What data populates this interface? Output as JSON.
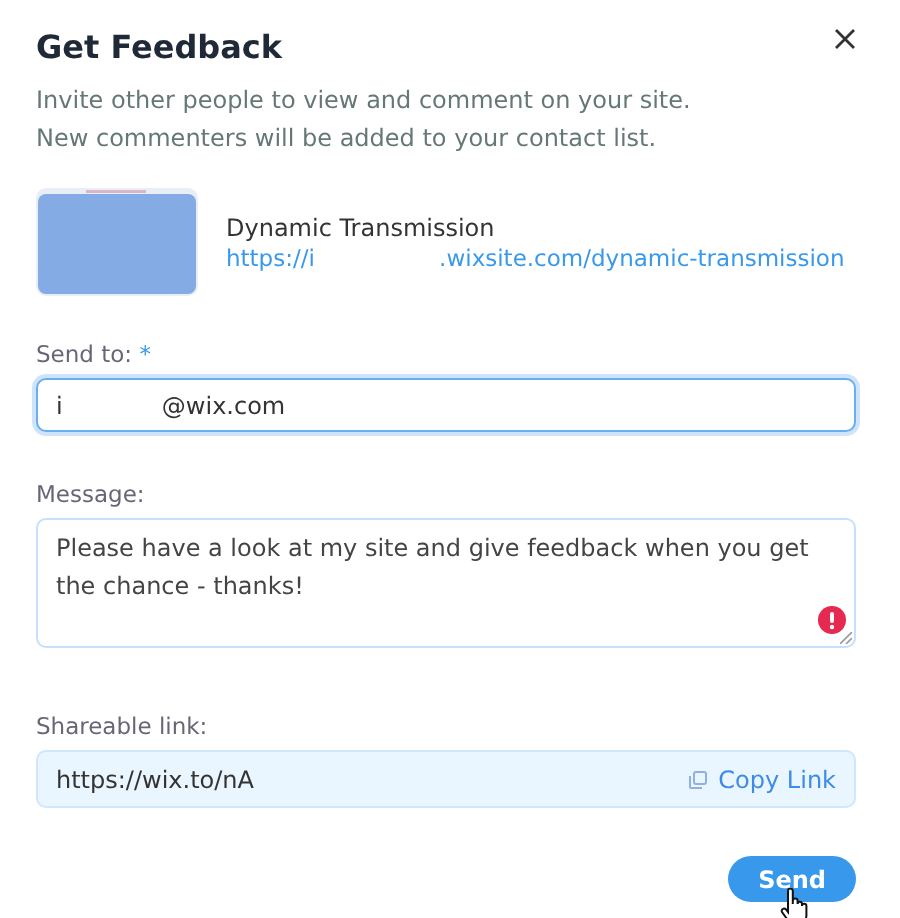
{
  "dialog": {
    "title": "Get Feedback",
    "description": [
      "Invite other people to view and comment on your site.",
      "New commenters will be added to your contact list."
    ]
  },
  "site": {
    "name": "Dynamic Transmission",
    "url": "https://i                 .wixsite.com/dynamic-transmission"
  },
  "send_to": {
    "label": "Send to:",
    "required_mark": "*",
    "value": "i             @wix.com",
    "focused": true
  },
  "message": {
    "label": "Message:",
    "value": "Please have a look at my site and give feedback when you get the chance - thanks!",
    "error": true
  },
  "shareable_link": {
    "label": "Shareable link:",
    "value": "https://wix.to/nA",
    "copy_label": "Copy Link"
  },
  "buttons": [
    {
      "label": "Send",
      "kind": "primary"
    }
  ]
}
